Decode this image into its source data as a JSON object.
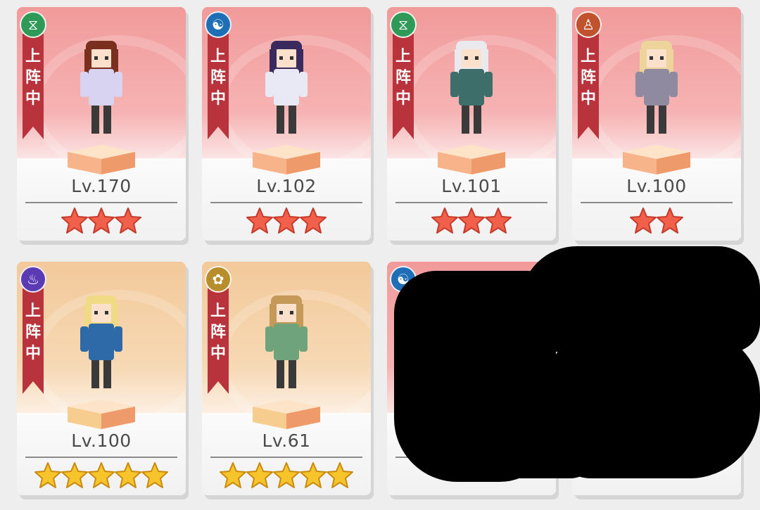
{
  "status_label_chars": [
    "上",
    "阵",
    "中"
  ],
  "colors": {
    "red_frame": "#f19a9a",
    "orange_frame": "#f2c99a",
    "star_red": "#f0604a",
    "star_gold": "#f7c52b",
    "ribbon": "#b9333c"
  },
  "cards": [
    {
      "level": "Lv.170",
      "stars": 3,
      "star_color": "red",
      "frame": "red",
      "element_icon": "dna-icon",
      "element_glyph": "⧖",
      "element_color": "#2f9a57",
      "deployed": true,
      "hair": "#7a2f1f",
      "outfit": "#d7d3f0"
    },
    {
      "level": "Lv.102",
      "stars": 3,
      "star_color": "red",
      "frame": "red",
      "element_icon": "yin-yang-icon",
      "element_glyph": "☯",
      "element_color": "#1f6fb6",
      "deployed": true,
      "hair": "#3b2a5e",
      "outfit": "#e9e9f5"
    },
    {
      "level": "Lv.101",
      "stars": 3,
      "star_color": "red",
      "frame": "red",
      "element_icon": "dna-icon",
      "element_glyph": "⧖",
      "element_color": "#2f9a57",
      "deployed": true,
      "hair": "#e9e9ee",
      "outfit": "#3e6e6a"
    },
    {
      "level": "Lv.100",
      "stars": 2,
      "star_color": "red",
      "frame": "red",
      "element_icon": "meditation-icon",
      "element_glyph": "♙",
      "element_color": "#c0522e",
      "deployed": true,
      "hair": "#ecd49a",
      "outfit": "#8f8aa0"
    },
    {
      "level": "Lv.100",
      "stars": 5,
      "star_color": "gold",
      "frame": "orange",
      "element_icon": "purple-flame-icon",
      "element_glyph": "♨",
      "element_color": "#5b3bb3",
      "deployed": true,
      "hair": "#f1da86",
      "outfit": "#2f6aa8"
    },
    {
      "level": "Lv.61",
      "stars": 5,
      "star_color": "gold",
      "frame": "orange",
      "element_icon": "lotus-icon",
      "element_glyph": "✿",
      "element_color": "#b88d2e",
      "deployed": true,
      "hair": "#c59a58",
      "outfit": "#6ea37b"
    },
    {
      "level": "",
      "stars": 0,
      "star_color": "red",
      "frame": "red",
      "element_icon": "yin-yang-icon",
      "element_glyph": "☯",
      "element_color": "#1f6fb6",
      "deployed": false,
      "hair": "",
      "outfit": "",
      "censored": true
    },
    {
      "level": "",
      "stars": 0,
      "star_color": "gold",
      "frame": "orange",
      "element_icon": "purple-flame-icon",
      "element_glyph": "♨",
      "element_color": "#5b3bb3",
      "deployed": false,
      "hair": "",
      "outfit": "",
      "censored": true
    }
  ]
}
